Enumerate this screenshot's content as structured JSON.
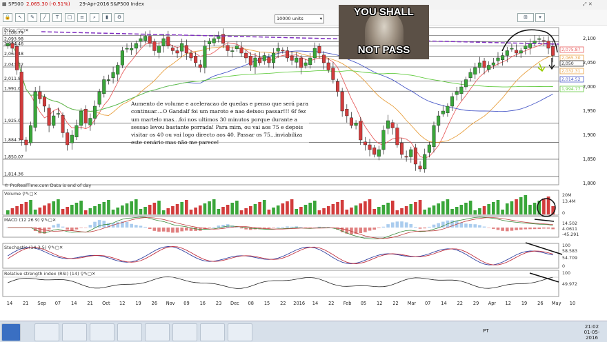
{
  "window": {
    "symbol": "SP500",
    "quote": "2,065.30 (-0.51%)",
    "date": "29-Apr-2016",
    "instrument": "S&P500 Index"
  },
  "toolbar": {
    "units_value": "10000 units"
  },
  "meme": {
    "line1": "YOU SHALL",
    "line2": "NOT PASS"
  },
  "annotation_text": "Aumento de volume e aceleracao de quedas e penso que será para continuar....O Gandalf foi um maroto e nao deixou passar!!! 6f fez um martelo mas...foi nos ultimos 30 minutos porque durante a sessao levou bastante porrada! Para mim, ou vai aos 75 e depois visitar os 40 ou vai logo directo aos 40. Passar os 75...inviabiliza este cenário mas não me parece!",
  "footer_credit": "© ProRealTime.com  Data is end of day",
  "panels": {
    "price": {
      "label": "Price"
    },
    "volume": {
      "label": "Volume"
    },
    "macd": {
      "label": "MACD (12 26 9)"
    },
    "stochastic": {
      "label": "Stochastic (14 3 5)"
    },
    "rsi": {
      "label": "Relative strength index (RSI) (14)"
    }
  },
  "taskbar": {
    "lang": "PT",
    "time": "21:02",
    "date": "01-05-2016"
  },
  "colors": {
    "up": "#3aa63a",
    "down": "#d23c3c",
    "ma_red": "#e86060",
    "ma_blue": "#4a5ac8",
    "ma_green": "#66cc44",
    "ma_orange": "#e8a040",
    "resistance": "#8030c0"
  },
  "chart_data": {
    "type": "candlestick",
    "x_ticks": [
      "14",
      "21",
      "Sep",
      "07",
      "14",
      "21",
      "Oct",
      "12",
      "19",
      "26",
      "Nov",
      "09",
      "16",
      "23",
      "Dec",
      "08",
      "15",
      "22",
      "2016",
      "14",
      "22",
      "Feb",
      "05",
      "12",
      "22",
      "Mar",
      "07",
      "14",
      "22",
      "29",
      "Apr",
      "12",
      "19",
      "26",
      "May",
      "10"
    ],
    "y_right_ticks": [
      "2,100",
      "2,050",
      "2,000",
      "1,950",
      "1,900",
      "1,850",
      "1,800"
    ],
    "y_left_levels": [
      "2,106.79",
      "2,093.98",
      "2,084.46",
      "2,063.48",
      "2,041.32",
      "2,011.87",
      "1,991.09",
      "1,925.02",
      "1,884.7",
      "1,850.07",
      "1,814.36"
    ],
    "ylim": [
      1800,
      2120
    ],
    "price_labels": [
      {
        "value": "2,075.87",
        "color": "#e86060"
      },
      {
        "value": "2,065.30",
        "color": "#e8a040"
      },
      {
        "value": "2,050",
        "color": "#333333"
      },
      {
        "value": "2,032.31",
        "color": "#e8a040"
      },
      {
        "value": "2,014.52",
        "color": "#4a5ac8"
      },
      {
        "value": "1,994.77",
        "color": "#66cc44"
      }
    ],
    "closes": [
      2090,
      2080,
      2035,
      1890,
      1880,
      1920,
      1990,
      1975,
      1960,
      1920,
      1940,
      1945,
      1905,
      1880,
      1900,
      1920,
      1950,
      1925,
      1935,
      1960,
      1990,
      2015,
      2015,
      2030,
      2045,
      2075,
      2080,
      2080,
      2090,
      2100,
      2105,
      2090,
      2075,
      2085,
      2100,
      2085,
      2075,
      2070,
      2090,
      2070,
      2060,
      2050,
      2040,
      2085,
      2095,
      2100,
      2105,
      2090,
      2075,
      2075,
      2085,
      2070,
      2060,
      2045,
      2060,
      2050,
      2065,
      2050,
      2070,
      2080,
      2075,
      2060,
      2055,
      2060,
      2040,
      2050,
      2060,
      2080,
      2070,
      2050,
      2035,
      2015,
      1990,
      1950,
      1940,
      1920,
      1925,
      1890,
      1880,
      1870,
      1860,
      1870,
      1910,
      1930,
      1915,
      1880,
      1860,
      1855,
      1870,
      1840,
      1830,
      1860,
      1880,
      1920,
      1940,
      1950,
      1960,
      1980,
      1990,
      2000,
      2015,
      2030,
      2040,
      2050,
      2040,
      2045,
      2050,
      2060,
      2065,
      2075,
      2080,
      2070,
      2075,
      2085,
      2090,
      2095,
      2100,
      2095,
      2080,
      2065
    ],
    "volume": {
      "label_values": [
        "20M",
        "13.4M",
        "0"
      ]
    },
    "macd": {
      "label_values": [
        "14.502",
        "4.0611",
        "-45.291"
      ]
    },
    "stochastic": {
      "label_values": [
        "100",
        "58.583",
        "54.709",
        "0"
      ]
    },
    "rsi": {
      "label_values": [
        "100",
        "49.972"
      ]
    }
  }
}
